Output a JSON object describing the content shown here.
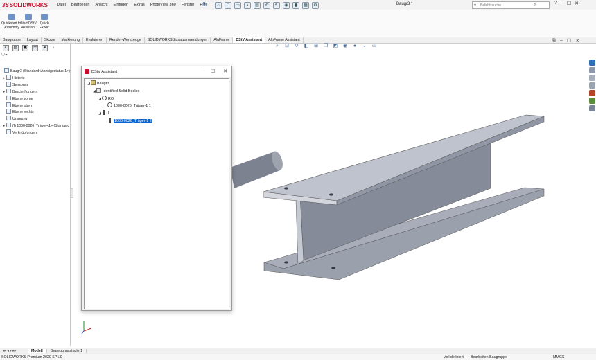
{
  "app": {
    "logo_ds": "3S",
    "logo_name": "SOLIDWORKS",
    "menu": [
      "Datei",
      "Bearbeiten",
      "Ansicht",
      "Einfügen",
      "Extras",
      "PhotoView 360",
      "Fenster",
      "Hilfe"
    ],
    "document_title": "Baugr3 *",
    "search_placeholder": "Befehlssuche",
    "window_controls": [
      "?",
      "–",
      "☐",
      "✕"
    ]
  },
  "command_manager": {
    "buttons": [
      {
        "label": "Quickstart for Assembly"
      },
      {
        "label": "Start DStV Assistant"
      },
      {
        "label": "Quick Export"
      }
    ]
  },
  "tabs": [
    {
      "label": "Baugruppe",
      "active": false
    },
    {
      "label": "Layout",
      "active": false
    },
    {
      "label": "Skizze",
      "active": false
    },
    {
      "label": "Markierung",
      "active": false
    },
    {
      "label": "Evaluieren",
      "active": false
    },
    {
      "label": "Render-Werkzeuge",
      "active": false
    },
    {
      "label": "SOLIDWORKS Zusatzanwendungen",
      "active": false
    },
    {
      "label": "AluFrame",
      "active": false
    },
    {
      "label": "DStV Assistant",
      "active": true
    },
    {
      "label": "AluFrame Assistant",
      "active": false
    }
  ],
  "feature_tree": [
    {
      "label": "Baugr3  (Standard<Anzeigestatus-1>)",
      "level": 0,
      "expander": ""
    },
    {
      "label": "Historie",
      "level": 1,
      "expander": "▸"
    },
    {
      "label": "Sensoren",
      "level": 1,
      "expander": ""
    },
    {
      "label": "Beschriftungen",
      "level": 1,
      "expander": "▸"
    },
    {
      "label": "Ebene vorne",
      "level": 1,
      "expander": ""
    },
    {
      "label": "Ebene oben",
      "level": 1,
      "expander": ""
    },
    {
      "label": "Ebene rechts",
      "level": 1,
      "expander": ""
    },
    {
      "label": "Ursprung",
      "level": 1,
      "expander": ""
    },
    {
      "label": "(f) 1000-0026_Träger<1> (Standard",
      "level": 1,
      "expander": "▸"
    },
    {
      "label": "Verknüpfungen",
      "level": 1,
      "expander": ""
    }
  ],
  "dialog": {
    "title": "DStV Assistant",
    "controls": [
      "–",
      "☐",
      "✕"
    ],
    "tree": [
      {
        "label": "Baugr3",
        "level": 0,
        "expander": "◢",
        "icon": "assembly-icon",
        "selected": false
      },
      {
        "label": "Identified Solid Bodies",
        "level": 1,
        "expander": "◢",
        "icon": "solid-bodies-icon",
        "selected": false
      },
      {
        "label": "RO",
        "level": 2,
        "expander": "◢",
        "icon": "round-profile-icon",
        "selected": false
      },
      {
        "label": "1000-0026_Träger-1 1",
        "level": 3,
        "expander": "",
        "icon": "round-profile-icon",
        "selected": false
      },
      {
        "label": "I",
        "level": 2,
        "expander": "◢",
        "icon": "i-beam-icon",
        "selected": false
      },
      {
        "label": "1000-0026_Träger-1 2",
        "level": 3,
        "expander": "",
        "icon": "i-beam-icon",
        "selected": true
      }
    ]
  },
  "bottom_tabs": [
    {
      "label": "Modell",
      "active": true
    },
    {
      "label": "Bewegungsstudie 1",
      "active": false
    }
  ],
  "status": {
    "left": "SOLIDWORKS Premium 2020 SP1.0",
    "definition": "Voll definiert",
    "mode": "Bearbeiten Baugruppe",
    "units": "MMGS"
  },
  "colors": {
    "brand_red": "#c8102e",
    "selection_blue": "#0a64d1",
    "beam_top": "#b7bcc8",
    "beam_web": "#8c92a0"
  }
}
